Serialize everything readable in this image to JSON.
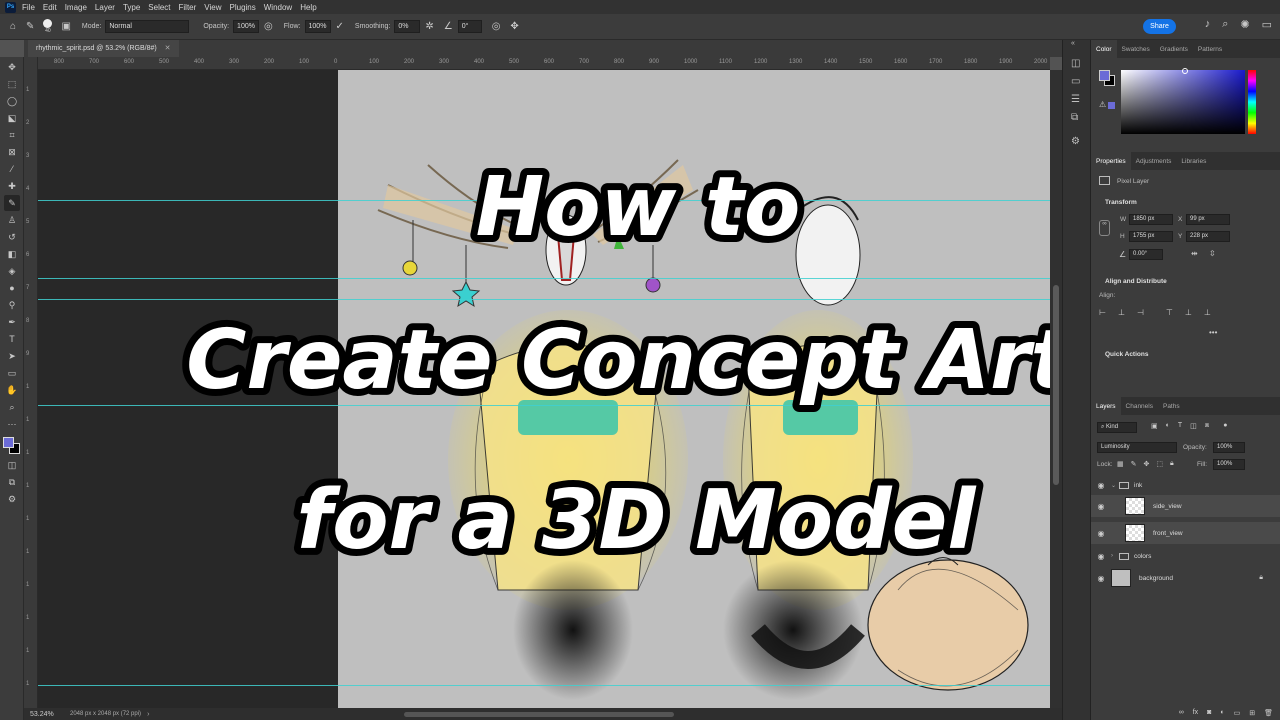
{
  "app": {
    "logo": "Ps",
    "menus": [
      "File",
      "Edit",
      "Image",
      "Layer",
      "Type",
      "Select",
      "Filter",
      "View",
      "Plugins",
      "Window",
      "Help"
    ]
  },
  "options_bar": {
    "brush_size": "40",
    "mode_label": "Mode:",
    "mode_value": "Normal",
    "opacity_label": "Opacity:",
    "opacity_value": "100%",
    "flow_label": "Flow:",
    "flow_value": "100%",
    "smoothing_label": "Smoothing:",
    "smoothing_value": "0%",
    "angle_value": "0°",
    "share_label": "Share"
  },
  "document": {
    "tab_title": "rhythmic_spirit.psd @ 53.2% (RGB/8#)",
    "zoom": "53.24%",
    "doc_info": "2048 px x 2048 px (72 ppi)"
  },
  "ruler": {
    "h_ticks": [
      "800",
      "700",
      "600",
      "500",
      "400",
      "300",
      "200",
      "100",
      "0",
      "100",
      "200",
      "300",
      "400",
      "500",
      "600",
      "700",
      "800",
      "900",
      "1000",
      "1100",
      "1200",
      "1300",
      "1400",
      "1500",
      "1600",
      "1700",
      "1800",
      "1900",
      "2000"
    ],
    "v_ticks": [
      "1",
      "2",
      "3",
      "4",
      "5",
      "6",
      "7",
      "8",
      "9",
      "1",
      "1",
      "1",
      "1",
      "1",
      "1",
      "1",
      "1",
      "1",
      "1"
    ]
  },
  "overlay_title": {
    "line1": "How to",
    "line2": "Create Concept Art",
    "line3": "for a 3D Model"
  },
  "color_panel": {
    "tabs": [
      "Color",
      "Swatches",
      "Gradients",
      "Patterns"
    ],
    "foreground": "#6b6bd6",
    "background": "#000000"
  },
  "properties_panel": {
    "tabs": [
      "Properties",
      "Adjustments",
      "Libraries"
    ],
    "layer_type": "Pixel Layer",
    "transform_title": "Transform",
    "w_label": "W",
    "w_value": "1850 px",
    "x_label": "X",
    "x_value": "99 px",
    "h_label": "H",
    "h_value": "1755 px",
    "y_label": "Y",
    "y_value": "228 px",
    "angle_value": "0.00°",
    "align_title": "Align and Distribute",
    "align_label": "Align:",
    "quick_actions": "Quick Actions"
  },
  "layers_panel": {
    "tabs": [
      "Layers",
      "Channels",
      "Paths"
    ],
    "filter_kind": "Kind",
    "blend_mode": "Luminosity",
    "opacity_label": "Opacity:",
    "opacity_value": "100%",
    "lock_label": "Lock:",
    "fill_label": "Fill:",
    "fill_value": "100%",
    "layers": [
      {
        "name": "ink",
        "type": "group",
        "expanded": true
      },
      {
        "name": "side_view",
        "type": "pixel",
        "selected": true
      },
      {
        "name": "front_view",
        "type": "pixel",
        "selected": true
      },
      {
        "name": "colors",
        "type": "group",
        "expanded": false
      },
      {
        "name": "background",
        "type": "pixel",
        "locked": true
      }
    ]
  },
  "colors": {
    "accent": "#1473e6",
    "guide": "#3fd0d0",
    "canvas": "#bfbfbf"
  }
}
